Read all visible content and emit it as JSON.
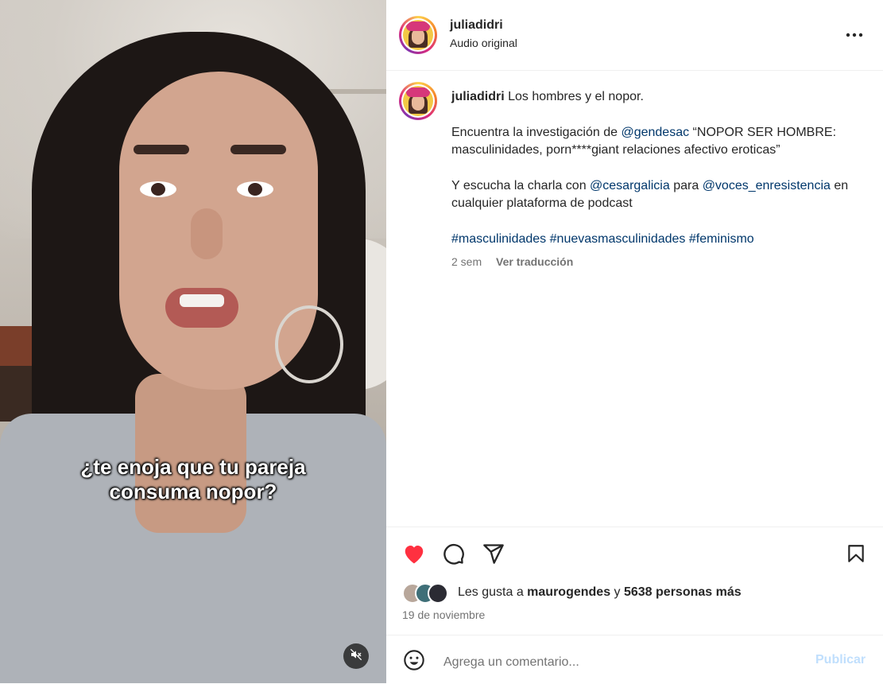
{
  "media": {
    "caption_line1": "¿te enoja que tu pareja",
    "caption_line2": "consuma nopor?",
    "mute_icon": "speaker-muted-icon"
  },
  "header": {
    "username": "juliadidri",
    "audio": "Audio original",
    "more_icon": "more-options-icon"
  },
  "post": {
    "username": "juliadidri",
    "title": "Los hombres y el nopor.",
    "p2_pre": "Encuentra la investigación de ",
    "p2_mention": "@gendesac",
    "p2_post": " “NOPOR SER HOMBRE: masculinidades, porn****giant relaciones afectivo eroticas”",
    "p3_pre": "Y escucha la charla con ",
    "p3_mention1": "@cesargalicia",
    "p3_mid": " para ",
    "p3_mention2": "@voces_enresistencia",
    "p3_post": " en cualquier plataforma de podcast",
    "hashtags": [
      "#masculinidades",
      "#nuevasmasculinidades",
      "#feminismo"
    ],
    "age": "2 sem",
    "translate": "Ver traducción"
  },
  "actions": {
    "like_liked": true,
    "like_color": "#ff3040"
  },
  "likes": {
    "prefix": "Les gusta a ",
    "user": "maurogendes",
    "mid": " y ",
    "count": "5638 personas más"
  },
  "date": "19 de noviembre",
  "comment": {
    "placeholder": "Agrega un comentario...",
    "publish": "Publicar"
  }
}
